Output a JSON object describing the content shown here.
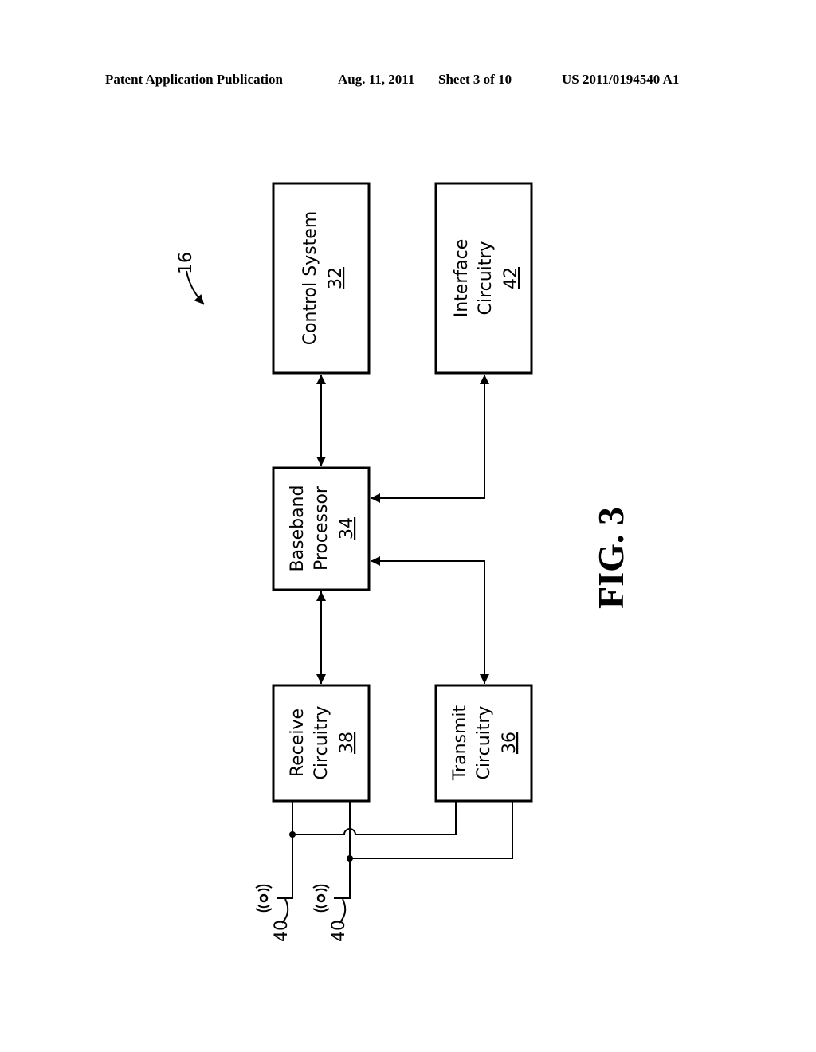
{
  "header": {
    "publication": "Patent Application Publication",
    "date": "Aug. 11, 2011",
    "sheet": "Sheet 3 of 10",
    "number": "US 2011/0194540 A1"
  },
  "figure": {
    "label": "FIG. 3",
    "ref": "16"
  },
  "blocks": {
    "control_system": {
      "line1": "Control System",
      "ref": "32"
    },
    "interface_circuitry": {
      "line1": "Interface",
      "line2": "Circuitry",
      "ref": "42"
    },
    "baseband_processor": {
      "line1": "Baseband",
      "line2": "Processor",
      "ref": "34"
    },
    "receive_circuitry": {
      "line1": "Receive",
      "line2": "Circuitry",
      "ref": "38"
    },
    "transmit_circuitry": {
      "line1": "Transmit",
      "line2": "Circuitry",
      "ref": "36"
    }
  },
  "antennas": [
    {
      "ref": "40"
    },
    {
      "ref": "40"
    }
  ]
}
